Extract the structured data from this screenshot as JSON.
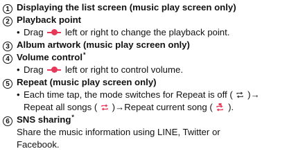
{
  "items": [
    {
      "number": "1",
      "title": "Displaying the list screen (music play screen only)",
      "star": ""
    },
    {
      "number": "2",
      "title": "Playback point",
      "star": "",
      "bullet": {
        "before": "Drag",
        "after": "left or right to change the playback point."
      }
    },
    {
      "number": "3",
      "title": "Album artwork (music play screen only)",
      "star": ""
    },
    {
      "number": "4",
      "title": "Volume control",
      "star": "*",
      "bullet": {
        "before": "Drag",
        "after": "left or right to control volume."
      }
    },
    {
      "number": "5",
      "title": "Repeat (music play screen only)",
      "star": "",
      "bullet": {
        "line1_before": "Each time tap, the mode switches for Repeat is off (",
        "line1_after": ")→",
        "line2_a": "Repeat all songs (",
        "line2_b": ")→Repeat current song (",
        "line2_c": ")."
      }
    },
    {
      "number": "6",
      "title": "SNS sharing",
      "star": "*",
      "body": [
        "Share the music information using LINE, Twitter or",
        "Facebook."
      ]
    }
  ],
  "bullet_char": "•",
  "colors": {
    "slider": "#e8385a",
    "repeat_off": "#444444",
    "repeat_on": "#e8385a",
    "text": "#111111"
  }
}
